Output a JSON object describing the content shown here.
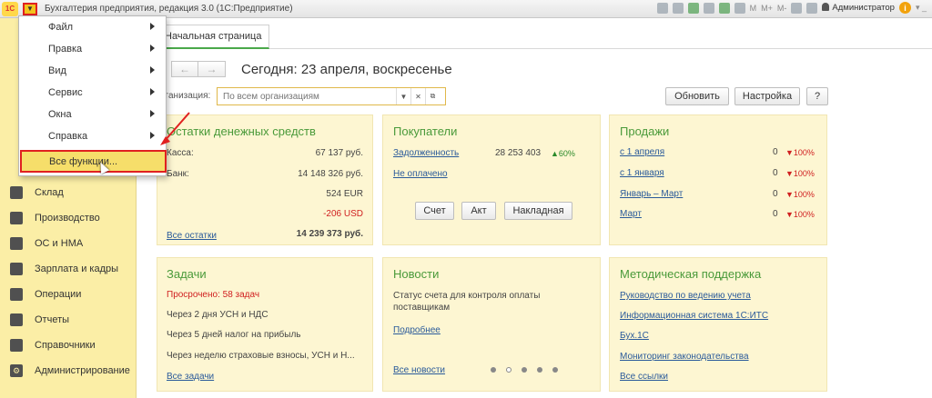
{
  "app": {
    "title": "Бухгалтерия предприятия, редакция 3.0  (1С:Предприятие)",
    "logo_text": "1С",
    "user": "Администратор",
    "toolbar_text": [
      "M",
      "M+",
      "M-"
    ]
  },
  "menu": {
    "items": [
      {
        "label": "Файл",
        "submenu": true
      },
      {
        "label": "Правка",
        "submenu": true
      },
      {
        "label": "Вид",
        "submenu": true
      },
      {
        "label": "Сервис",
        "submenu": true
      },
      {
        "label": "Окна",
        "submenu": true
      },
      {
        "label": "Справка",
        "submenu": true
      }
    ],
    "all_functions": "Все функции..."
  },
  "sidebar": {
    "items": [
      {
        "label": "Склад",
        "icon": "warehouse-icon"
      },
      {
        "label": "Производство",
        "icon": "factory-icon"
      },
      {
        "label": "ОС и НМА",
        "icon": "truck-icon"
      },
      {
        "label": "Зарплата и кадры",
        "icon": "person-icon"
      },
      {
        "label": "Операции",
        "icon": "operations-icon"
      },
      {
        "label": "Отчеты",
        "icon": "chart-icon"
      },
      {
        "label": "Справочники",
        "icon": "books-icon"
      },
      {
        "label": "Администрирование",
        "icon": "gear-icon"
      }
    ]
  },
  "tabs": {
    "home": "Начальная страница"
  },
  "header": {
    "date": "Сегодня: 23 апреля, воскресенье",
    "org_label": "рганизация:",
    "org_placeholder": "По всем организациям",
    "refresh": "Обновить",
    "settings": "Настройка",
    "help": "?"
  },
  "cash": {
    "title": "Остатки денежных средств",
    "kassa_label": "Касса:",
    "kassa_value": "67 137 руб.",
    "bank_label": "Банк:",
    "bank_value": "14 148 326 руб.",
    "eur_value": "524 EUR",
    "usd_value": "-206 USD",
    "all_link": "Все остатки",
    "total": "14 239 373 руб."
  },
  "buyers": {
    "title": "Покупатели",
    "debt_link": "Задолженность",
    "debt_value": "28 253 403",
    "debt_change": "▲60%",
    "unpaid_link": "Не оплачено",
    "btn_invoice": "Счет",
    "btn_act": "Акт",
    "btn_waybill": "Накладная"
  },
  "sales": {
    "title": "Продажи",
    "rows": [
      {
        "label": "с 1 апреля",
        "value": "0",
        "change": "▼100%"
      },
      {
        "label": "с 1 января",
        "value": "0",
        "change": "▼100%"
      },
      {
        "label": "Январь – Март",
        "value": "0",
        "change": "▼100%"
      },
      {
        "label": "Март",
        "value": "0",
        "change": "▼100%"
      }
    ]
  },
  "tasks": {
    "title": "Задачи",
    "overdue": "Просрочено: 58 задач",
    "items": [
      "Через 2 дня УСН и НДС",
      "Через 5 дней налог на прибыль",
      "Через неделю страховые взносы, УСН и Н..."
    ],
    "all_link": "Все задачи"
  },
  "news": {
    "title": "Новости",
    "text_line1": "Статус счета для контроля оплаты",
    "text_line2": "поставщикам",
    "more_link": "Подробнее",
    "all_link": "Все новости"
  },
  "support": {
    "title": "Методическая поддержка",
    "links": [
      "Руководство по ведению учета",
      "Информационная система 1С:ИТС",
      "Бух.1С",
      "Мониторинг законодательства"
    ],
    "all_link": "Все ссылки"
  }
}
